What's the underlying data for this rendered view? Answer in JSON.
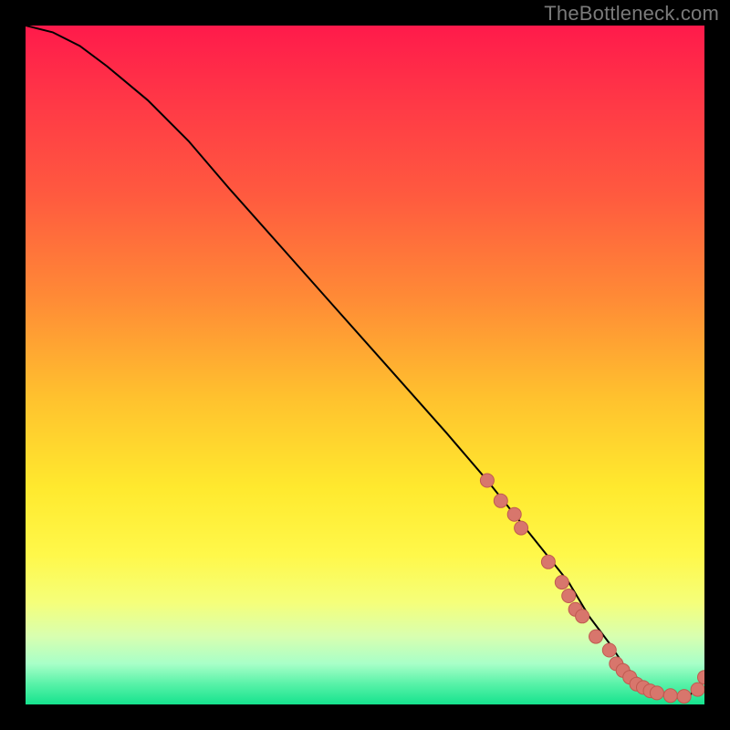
{
  "watermark": "TheBottleneck.com",
  "colors": {
    "background": "#000000",
    "curve": "#000000",
    "marker_fill": "#d8766c",
    "marker_stroke": "#c05a50"
  },
  "gradient_stops": [
    {
      "offset": 0.0,
      "color": "#ff1a4b"
    },
    {
      "offset": 0.12,
      "color": "#ff3a46"
    },
    {
      "offset": 0.25,
      "color": "#ff5a3f"
    },
    {
      "offset": 0.4,
      "color": "#ff8a36"
    },
    {
      "offset": 0.55,
      "color": "#ffc22e"
    },
    {
      "offset": 0.68,
      "color": "#ffe92e"
    },
    {
      "offset": 0.78,
      "color": "#fff84a"
    },
    {
      "offset": 0.85,
      "color": "#f5ff7a"
    },
    {
      "offset": 0.9,
      "color": "#d8ffb0"
    },
    {
      "offset": 0.94,
      "color": "#a8ffc8"
    },
    {
      "offset": 0.97,
      "color": "#58f2a8"
    },
    {
      "offset": 1.0,
      "color": "#15e38e"
    }
  ],
  "chart_data": {
    "type": "line",
    "title": "",
    "xlabel": "",
    "ylabel": "",
    "xlim": [
      0,
      100
    ],
    "ylim": [
      0,
      100
    ],
    "series": [
      {
        "name": "bottleneck-curve",
        "x": [
          0,
          4,
          8,
          12,
          18,
          24,
          30,
          38,
          46,
          54,
          62,
          68,
          72,
          76,
          80,
          83,
          86,
          88,
          90,
          92,
          94,
          96,
          98,
          100
        ],
        "y": [
          100,
          99,
          97,
          94,
          89,
          83,
          76,
          67,
          58,
          49,
          40,
          33,
          28,
          23,
          18,
          13,
          9,
          6,
          4,
          2,
          1.5,
          1,
          1.5,
          4
        ]
      }
    ],
    "markers": {
      "name": "highlight-points",
      "x": [
        68,
        70,
        72,
        73,
        77,
        79,
        80,
        81,
        82,
        84,
        86,
        87,
        88,
        89,
        90,
        91,
        92,
        93,
        95,
        97,
        99,
        100
      ],
      "y": [
        33,
        30,
        28,
        26,
        21,
        18,
        16,
        14,
        13,
        10,
        8,
        6,
        5,
        4,
        3,
        2.5,
        2,
        1.7,
        1.3,
        1.2,
        2.2,
        4
      ]
    }
  }
}
